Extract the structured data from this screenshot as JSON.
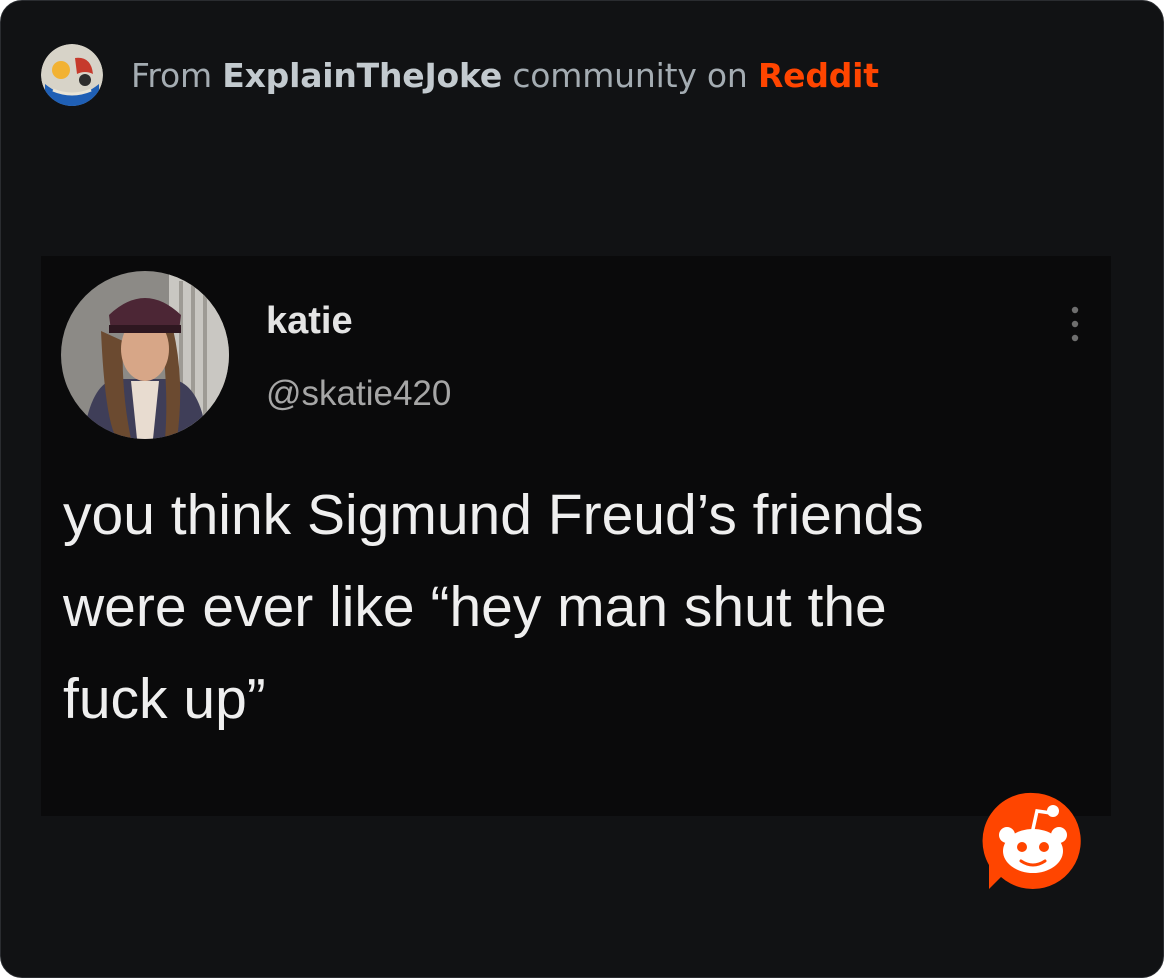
{
  "header": {
    "prefix": "From ",
    "community": "ExplainTheJoke",
    "middle": " community on ",
    "platform": "Reddit",
    "community_icon": "community-avatar-icon",
    "platform_color": "#ff4500"
  },
  "tweet": {
    "display_name": "katie",
    "handle": "@skatie420",
    "text": "you think Sigmund Freud’s friends\nwere ever like “hey man shut the\nfuck up”",
    "avatar_icon": "profile-photo",
    "menu_icon": "more-vertical-icon"
  },
  "footer": {
    "logo_icon": "reddit-snoo-icon"
  }
}
